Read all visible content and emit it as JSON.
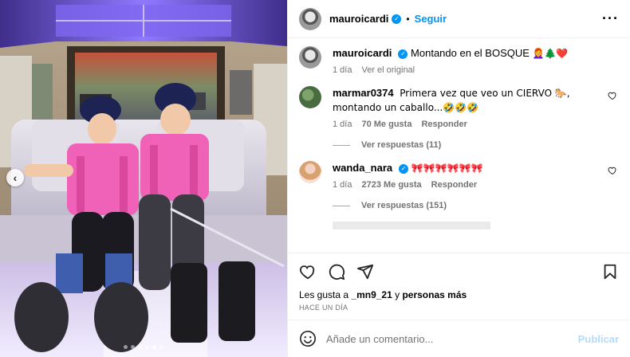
{
  "post": {
    "username": "mauroicardi",
    "follow_label": "Seguir",
    "caption": "Montando en el BOSQUE",
    "caption_emojis": "👩‍🦰🌲❤️",
    "caption_time": "1 día",
    "see_original": "Ver el original"
  },
  "comments": [
    {
      "username": "marmar0374",
      "text": "Primera vez que veo un CIERVO 🐎, montando un caballo...🤣🤣🤣",
      "time": "1 día",
      "likes": "70 Me gusta",
      "reply": "Responder",
      "view_replies": "Ver respuestas (11)"
    },
    {
      "username": "wanda_nara",
      "text": "🎀🎀🎀🎀🎀🎀",
      "time": "1 día",
      "likes": "2723 Me gusta",
      "reply": "Responder",
      "view_replies": "Ver respuestas (151)"
    }
  ],
  "likes_line": {
    "prefix": "Les gusta a",
    "user": "_mn9_21",
    "conj": "y",
    "others": "personas más"
  },
  "timestamp": "HACE UN DÍA",
  "composer": {
    "placeholder": "Añade un comentario...",
    "publish": "Publicar"
  },
  "carousel": {
    "total": 6,
    "active": 5
  },
  "colors": {
    "link_blue": "#0095f6",
    "publish_disabled": "#b3dbff",
    "vest_pink": "#ef62b8",
    "ceiling_purple": "#6a52d8"
  }
}
